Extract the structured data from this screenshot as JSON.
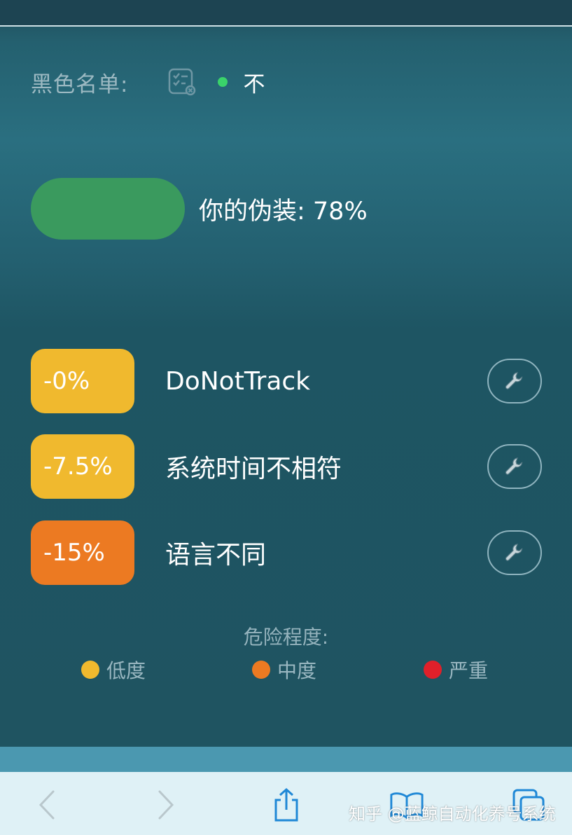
{
  "blacklist": {
    "label": "黑色名单:",
    "icon": "list-settings-icon",
    "status_color": "#3ad36a",
    "status_text": "不"
  },
  "disguise": {
    "bar_color": "#3a9a5e",
    "text": "你的伪装: 78%",
    "score_percent": 78
  },
  "issues": [
    {
      "badge": "-0%",
      "label": "DoNotTrack",
      "severity": "low",
      "color": "#f0b92e",
      "fix_icon": "wrench-icon"
    },
    {
      "badge": "-7.5%",
      "label": "系统时间不相符",
      "severity": "low",
      "color": "#f0b92e",
      "fix_icon": "wrench-icon"
    },
    {
      "badge": "-15%",
      "label": "语言不同",
      "severity": "medium",
      "color": "#ec7a22",
      "fix_icon": "wrench-icon"
    }
  ],
  "legend": {
    "title": "危险程度:",
    "items": [
      {
        "label": "低度",
        "color": "#f0b92e"
      },
      {
        "label": "中度",
        "color": "#ec7a22"
      },
      {
        "label": "严重",
        "color": "#e0202a"
      }
    ]
  },
  "toolbar": {
    "buttons": [
      "chevron-left-icon",
      "chevron-right-icon",
      "share-icon",
      "bookmarks-icon",
      "tabs-icon"
    ],
    "icon_color": "#1f88d6"
  },
  "watermark": "知乎 @蓝鲸自动化养号系统"
}
